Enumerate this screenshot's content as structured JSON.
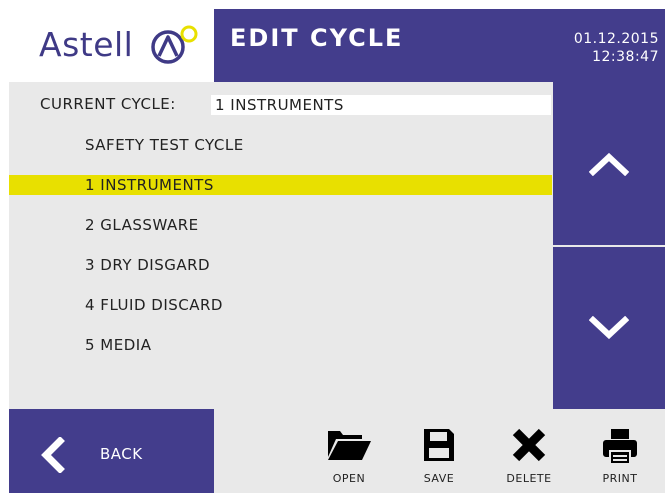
{
  "header": {
    "logo_text": "Astell",
    "title": "EDIT CYCLE",
    "date": "01.12.2015",
    "time": "12:38:47"
  },
  "current_cycle": {
    "label": "CURRENT CYCLE:",
    "value": "1 INSTRUMENTS"
  },
  "cycles": {
    "items": [
      {
        "label": "SAFETY TEST CYCLE"
      },
      {
        "label": "1 INSTRUMENTS"
      },
      {
        "label": "2 GLASSWARE"
      },
      {
        "label": "3 DRY DISGARD"
      },
      {
        "label": "4 FLUID DISCARD"
      },
      {
        "label": "5 MEDIA"
      }
    ],
    "selected_index": 1
  },
  "footer": {
    "back_label": "BACK",
    "open_label": "OPEN",
    "save_label": "SAVE",
    "delete_label": "DELETE",
    "print_label": "PRINT"
  },
  "colors": {
    "brand": "#433d8c",
    "highlight": "#e8e000",
    "background": "#e9e9e9",
    "logo_accent": "#e8e000"
  },
  "icons": [
    "chevron-up-icon",
    "chevron-down-icon",
    "chevron-left-icon",
    "folder-open-icon",
    "floppy-disk-icon",
    "x-delete-icon",
    "printer-icon"
  ]
}
